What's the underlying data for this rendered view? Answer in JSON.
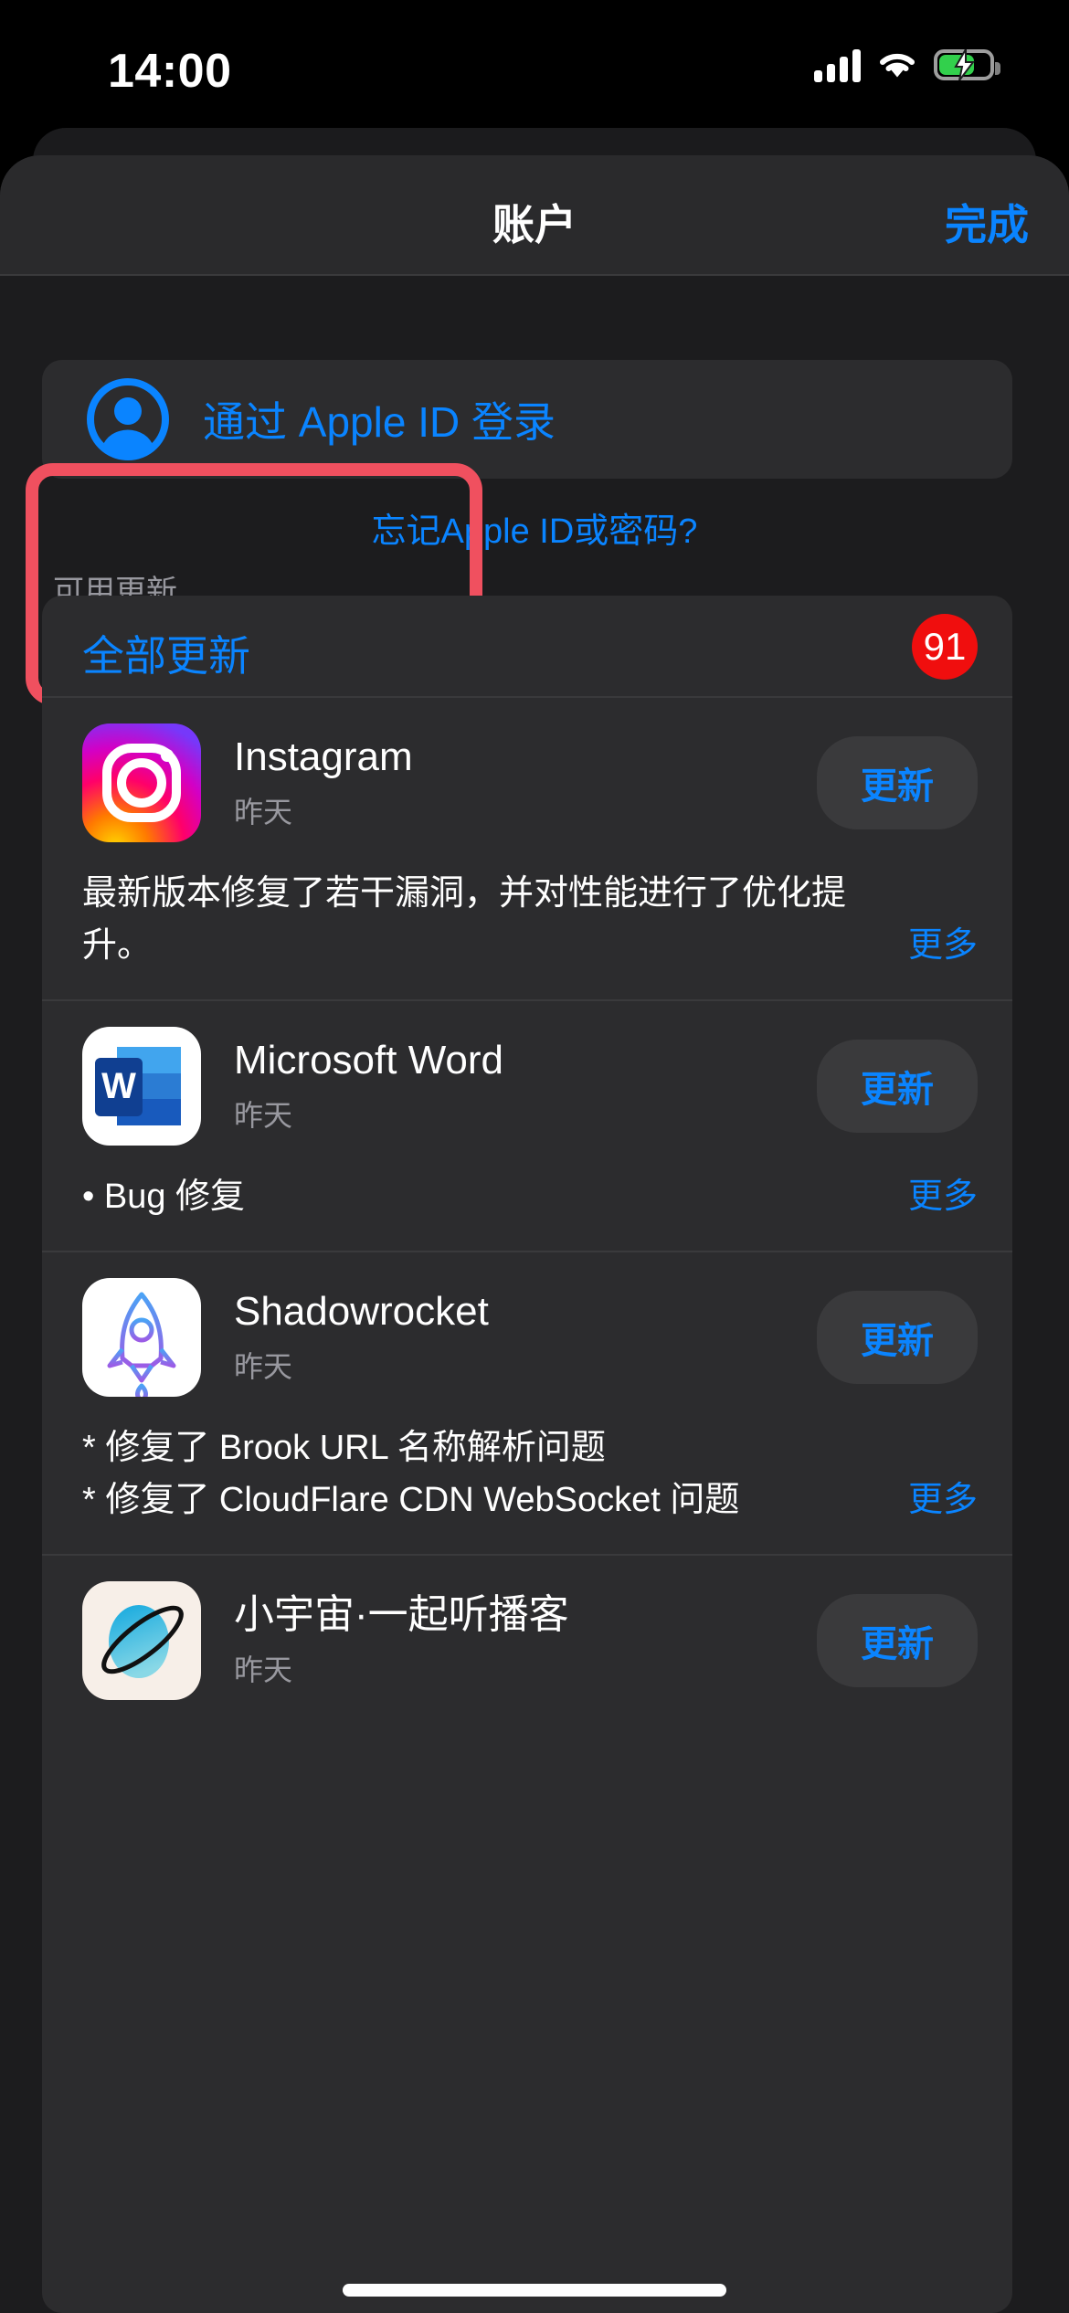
{
  "status_bar": {
    "time": "14:00",
    "icons": [
      "cellular-signal-icon",
      "wifi-icon",
      "battery-charging-icon"
    ],
    "battery_charging": true
  },
  "nav": {
    "title": "账户",
    "done_label": "完成"
  },
  "account": {
    "signin_label": "通过 Apple ID 登录",
    "avatar_icon": "person-circle-icon",
    "forgot_label": "忘记Apple ID或密码?",
    "highlight_color": "#F0505F"
  },
  "updates": {
    "section_header": "可用更新",
    "update_all_label": "全部更新",
    "badge_count": "91",
    "badge_color": "#F00E0E",
    "accent_color": "#0A84FF",
    "apps": [
      {
        "name": "Instagram",
        "date": "昨天",
        "button_label": "更新",
        "notes": "最新版本修复了若干漏洞，并对性能进行了优化提升。",
        "more_label": "更多",
        "icon": "instagram-icon"
      },
      {
        "name": "Microsoft Word",
        "date": "昨天",
        "button_label": "更新",
        "notes": "• Bug 修复",
        "more_label": "更多",
        "icon": "microsoft-word-icon"
      },
      {
        "name": "Shadowrocket",
        "date": "昨天",
        "button_label": "更新",
        "notes": "* 修复了 Brook URL 名称解析问题\n* 修复了 CloudFlare CDN WebSocket 问题",
        "more_label": "更多",
        "icon": "shadowrocket-icon"
      },
      {
        "name": "小宇宙·一起听播客",
        "date": "昨天",
        "button_label": "更新",
        "notes": "",
        "more_label": "",
        "icon": "xiaoyuzhou-icon"
      }
    ]
  }
}
